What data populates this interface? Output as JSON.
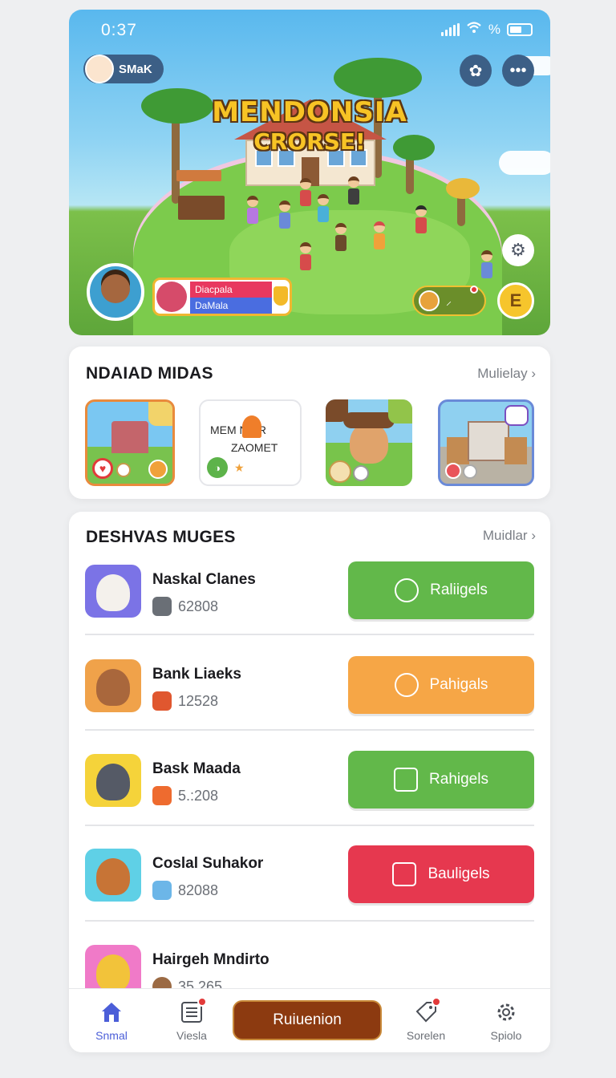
{
  "status": {
    "time": "0:37",
    "battery_pct_label": "%"
  },
  "hero": {
    "user_name": "SMaK",
    "title": "MENDONSIA",
    "subtitle": "CRORSE!",
    "player_line1": "Diacpala",
    "player_line2": "DaMala",
    "gold_symbol": "E"
  },
  "featured": {
    "title": "NDAIAD MIDAS",
    "link": "Mulielay",
    "chevron": "›",
    "tile2_text1": "MEM  NIBR",
    "tile2_text2": "ZAOMET",
    "tile2_star": "★"
  },
  "list": {
    "title": "DESHVAS MUGES",
    "link": "Muidlar",
    "chevron": "›",
    "items": [
      {
        "name": "Naskal Clanes",
        "count": "62808",
        "action": "Raliigels",
        "color": "#62b84a",
        "icon_bg": "#7b73e6",
        "face": "#f4f1ec",
        "meta_icon": "#6a6f76"
      },
      {
        "name": "Bank Liaeks",
        "count": "12528",
        "action": "Pahigals",
        "color": "#f6a646",
        "icon_bg": "#f0a24a",
        "face": "#a9673c",
        "meta_icon": "#e0572f"
      },
      {
        "name": "Bask Maada",
        "count": "5.:208",
        "action": "Rahigels",
        "color": "#62b84a",
        "icon_bg": "#f5d33a",
        "face": "#555a66",
        "meta_icon": "#ee6b2f"
      },
      {
        "name": "Coslal Suhakor",
        "count": "82088",
        "action": "Bauligels",
        "color": "#e6384f",
        "icon_bg": "#5fd0e6",
        "face": "#c77436",
        "meta_icon": "#6cb6e8"
      },
      {
        "name": "Hairgeh Mndirto",
        "count": "35 265",
        "action": "",
        "color": "",
        "icon_bg": "#f07ac8",
        "face": "#f2c33a",
        "meta_icon": "#9b6a44"
      }
    ]
  },
  "bottom_nav": {
    "home": "Snmal",
    "news": "Viesla",
    "cta": "Ruiuenion",
    "tags": "Sorelen",
    "settings": "Spiolo"
  }
}
